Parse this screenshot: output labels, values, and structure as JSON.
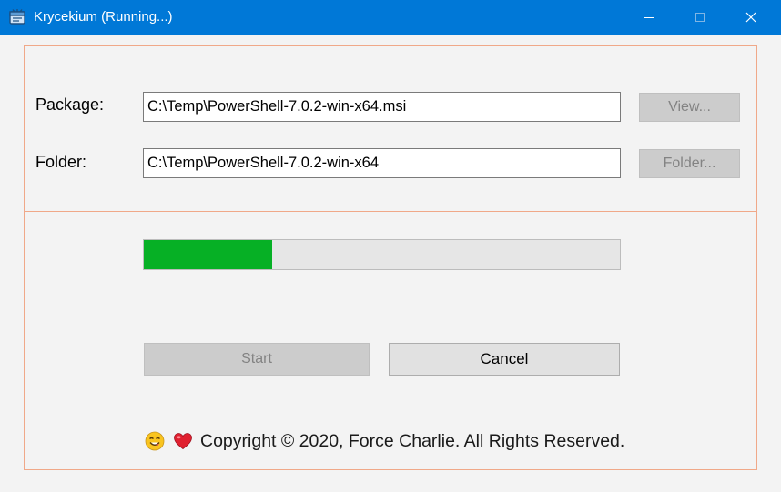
{
  "window": {
    "title": "Krycekium (Running...)",
    "accent_color": "#0078d7",
    "app_icon": "package-icon",
    "controls": [
      "minimize-icon",
      "maximize-icon",
      "close-icon"
    ]
  },
  "form": {
    "package_label": "Package:",
    "package_value": "C:\\Temp\\PowerShell-7.0.2-win-x64.msi",
    "view_button": "View...",
    "folder_label": "Folder:",
    "folder_value": "C:\\Temp\\PowerShell-7.0.2-win-x64",
    "folder_button": "Folder..."
  },
  "progress": {
    "value": 0.27,
    "color": "#06b025"
  },
  "actions": {
    "start_label": "Start",
    "cancel_label": "Cancel"
  },
  "footer": {
    "icons": [
      "smiling-face-icon",
      "heart-icon"
    ],
    "text": "Copyright © 2020, Force Charlie. All Rights Reserved."
  }
}
